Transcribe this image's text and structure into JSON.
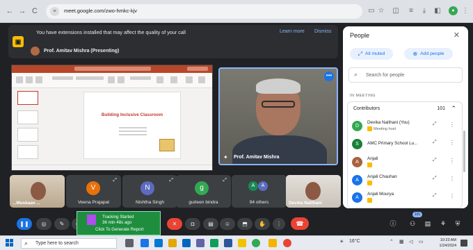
{
  "browser": {
    "url": "meet.google.com/zwo-hmkc-kjv",
    "nav": {
      "back": "←",
      "forward": "→",
      "reload": "C"
    },
    "toolbar_icons": [
      "cast-icon",
      "star-icon",
      "extensions-icon",
      "reading-list-icon",
      "download-icon",
      "sidepanel-icon",
      "menu-icon"
    ]
  },
  "banner": {
    "message": "You have extensions installed that may affect the quality of your call",
    "learn_more": "Learn more",
    "dismiss": "Dismiss"
  },
  "presenting": {
    "label": "Prof. Amitav Mishra (Presenting)"
  },
  "slide": {
    "title": "Building Inclusive Classroom"
  },
  "speaker": {
    "name": "Prof. Amitav Mishra"
  },
  "participants": [
    {
      "name": "...Muskaan ...",
      "initial": "",
      "type": "photo"
    },
    {
      "name": "Veena Prajapat",
      "initial": "V",
      "color": "#e8710a"
    },
    {
      "name": "Nishtha Singh",
      "initial": "N",
      "color": "#5c6bc0"
    },
    {
      "name": "gurleen bindra",
      "initial": "g",
      "color": "#33a852"
    },
    {
      "name": "94 others",
      "initial": "A",
      "color": "#1a73e8"
    },
    {
      "name": "Devika Naithani",
      "initial": "",
      "type": "photo"
    }
  ],
  "people_panel": {
    "title": "People",
    "close": "✕",
    "all_muted": "All muted",
    "add_people": "Add people",
    "search_placeholder": "Search for people",
    "section_label": "IN MEETING",
    "group_label": "Contributors",
    "group_count": "101",
    "people": [
      {
        "name": "Devika Naithani (You)",
        "role": "Meeting host",
        "initial": "D",
        "color": "#33a852"
      },
      {
        "name": "AMC Primary School Lu...",
        "role": "",
        "initial": "S",
        "color": "#188038"
      },
      {
        "name": "Anjali",
        "role": "",
        "initial": "A",
        "color": "#a5643f"
      },
      {
        "name": "Anjali Chauhan",
        "role": "",
        "initial": "A",
        "color": "#1a73e8"
      },
      {
        "name": "Anjali Mourya",
        "role": "",
        "initial": "A",
        "color": "#1a73e8"
      }
    ]
  },
  "tracking": {
    "line1": "Tracking Started",
    "line2": "36 min 48s ago",
    "line3": "Click To Generate Report"
  },
  "controls": {
    "people_badge": "101"
  },
  "taskbar": {
    "search_placeholder": "Type here to search",
    "weather": "16°C",
    "time": "10:23 AM",
    "date": "1/24/2024"
  },
  "colors": {
    "meet_bg": "#202124",
    "accent_blue": "#1a73e8",
    "end_call_red": "#ea4335",
    "tracking_green": "#1e8e3e"
  }
}
